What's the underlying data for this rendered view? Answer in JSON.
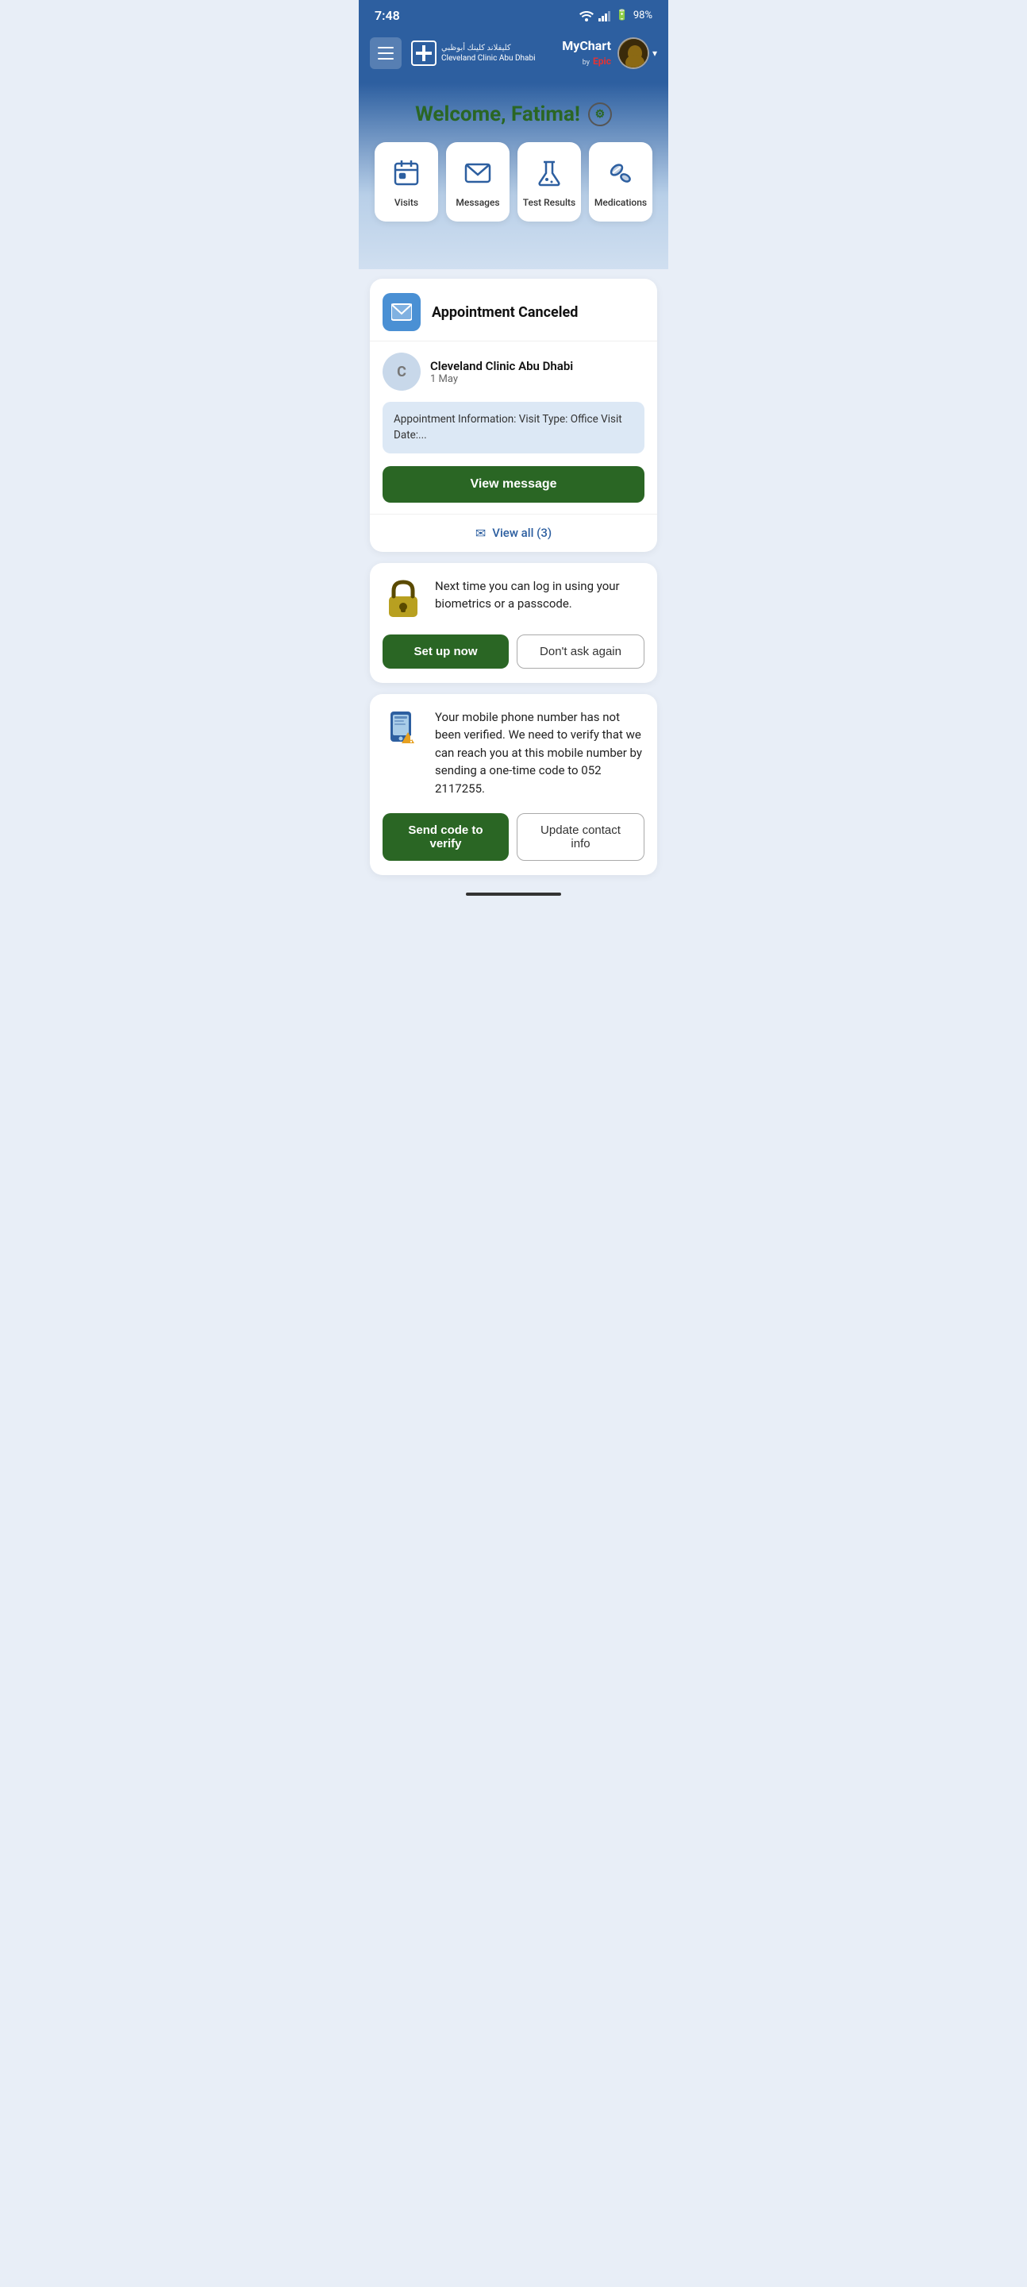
{
  "statusBar": {
    "time": "7:48",
    "battery": "98%",
    "batteryColor": "#f5c542"
  },
  "header": {
    "menuLabel": "Menu",
    "clinicNameEnglish": "Cleveland Clinic Abu Dhabi",
    "clinicNameArabic": "كليفلاند كلينك أبوظبي",
    "myChartLabel": "MyChart",
    "myChartBy": "by",
    "epicLabel": "Epic"
  },
  "welcome": {
    "title": "Welcome, Fatima!",
    "settingsLabel": "Settings"
  },
  "quickActions": [
    {
      "id": "visits",
      "label": "Visits",
      "icon": "calendar"
    },
    {
      "id": "messages",
      "label": "Messages",
      "icon": "envelope"
    },
    {
      "id": "test-results",
      "label": "Test Results",
      "icon": "flask"
    },
    {
      "id": "medications",
      "label": "Medications",
      "icon": "pills"
    }
  ],
  "appointmentCard": {
    "title": "Appointment Canceled",
    "clinicName": "Cleveland Clinic Abu Dhabi",
    "date": "1 May",
    "clinicInitial": "C",
    "preview": "Appointment Information:    Visit Type: Office Visit\nDate:...",
    "viewMessageLabel": "View message",
    "viewAllLabel": "View all (3)"
  },
  "biometricsCard": {
    "text": "Next time you can log in using your biometrics or a passcode.",
    "setupLabel": "Set up now",
    "dontAskLabel": "Don't ask again"
  },
  "phoneCard": {
    "text": "Your mobile phone number has not been verified. We need to verify that we can reach you at this mobile number by sending a one-time code to 052 2117255.",
    "sendCodeLabel": "Send code to verify",
    "updateContactLabel": "Update contact info"
  },
  "homeIndicator": {}
}
